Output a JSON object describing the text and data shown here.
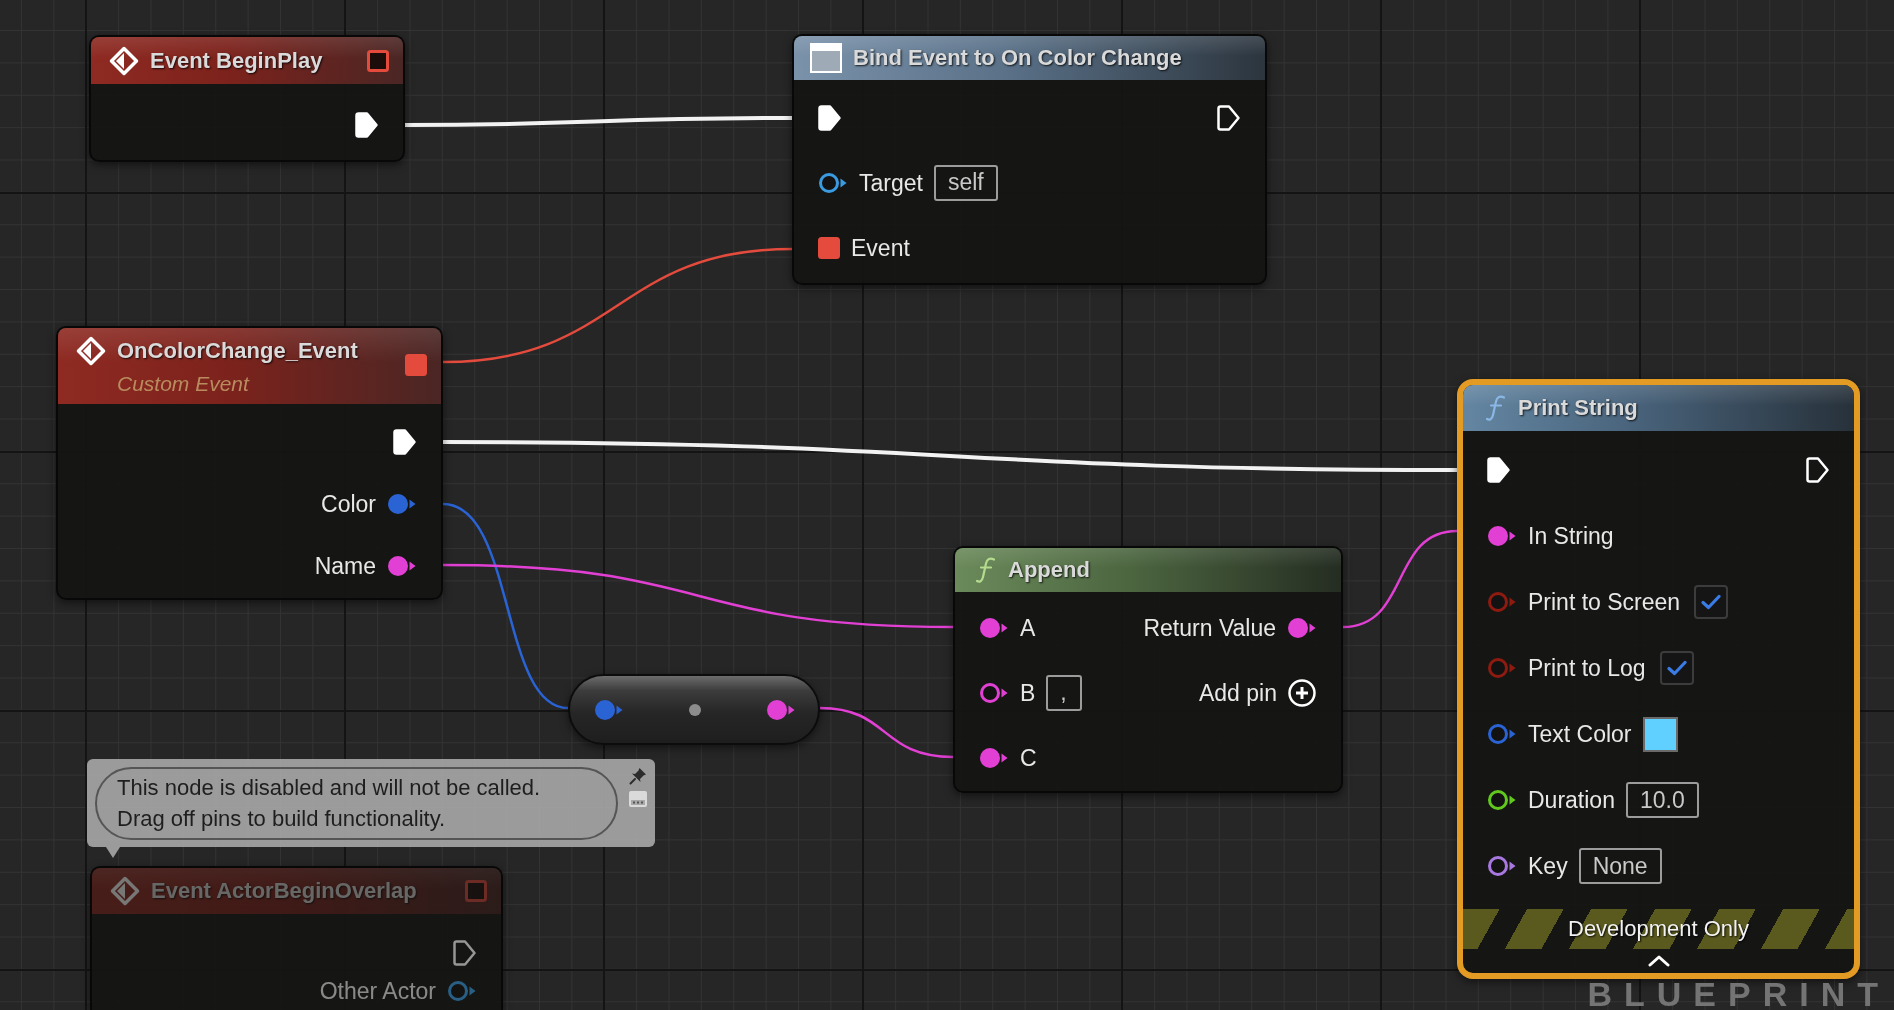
{
  "graph": {
    "corner_label": "BLUEPRINT",
    "nodes": [
      {
        "kind": "event",
        "title": "Event BeginPlay",
        "selected": false,
        "disabled": false,
        "delegate": {
          "connected": false
        },
        "rows": [
          {
            "output": {
              "kind": "exec",
              "connected": true
            }
          }
        ]
      },
      {
        "kind": "bind",
        "title": "Bind Event to On Color Change",
        "selected": false,
        "disabled": false,
        "rows": [
          {
            "input": {
              "kind": "exec",
              "connected": true
            },
            "output": {
              "kind": "exec",
              "connected": false
            }
          },
          {
            "input": {
              "kind": "object",
              "label": "Target",
              "value": "self",
              "connected": false
            }
          },
          {
            "input": {
              "kind": "delegate",
              "label": "Event",
              "connected": true
            }
          }
        ]
      },
      {
        "kind": "event",
        "title": "OnColorChange_Event",
        "subtitle": "Custom Event",
        "selected": false,
        "disabled": false,
        "delegate": {
          "connected": true
        },
        "rows": [
          {
            "output": {
              "kind": "exec",
              "connected": true
            }
          },
          {
            "output": {
              "kind": "struct",
              "label": "Color",
              "connected": true
            }
          },
          {
            "output": {
              "kind": "string",
              "label": "Name",
              "connected": true
            }
          }
        ]
      },
      {
        "kind": "conversion",
        "selected": false,
        "disabled": false,
        "rows": [
          {
            "input": {
              "kind": "struct",
              "connected": true
            },
            "output": {
              "kind": "string",
              "connected": true
            }
          }
        ]
      },
      {
        "kind": "pure",
        "title": "Append",
        "selected": false,
        "disabled": false,
        "rows": [
          {
            "input": {
              "kind": "string",
              "label": "A",
              "connected": true
            },
            "output": {
              "kind": "string",
              "label": "Return Value",
              "connected": true
            }
          },
          {
            "input": {
              "kind": "string",
              "label": "B",
              "value": ",",
              "connected": false
            },
            "output": {
              "kind": "add_pin",
              "label": "Add pin"
            }
          },
          {
            "input": {
              "kind": "string",
              "label": "C",
              "connected": true
            }
          }
        ]
      },
      {
        "kind": "event",
        "title": "Event ActorBeginOverlap",
        "selected": false,
        "disabled": true,
        "comment": "This node is disabled and will not be called.\nDrag off pins to build functionality.",
        "delegate": {
          "connected": false
        },
        "rows": [
          {
            "output": {
              "kind": "exec",
              "connected": false
            }
          },
          {
            "output": {
              "kind": "object",
              "label": "Other Actor",
              "connected": false
            }
          }
        ]
      },
      {
        "kind": "function",
        "title": "Print String",
        "selected": true,
        "disabled": false,
        "banner": "Development Only",
        "advanced_expanded": true,
        "rows": [
          {
            "input": {
              "kind": "exec",
              "connected": true
            },
            "output": {
              "kind": "exec",
              "connected": false
            }
          },
          {
            "input": {
              "kind": "string",
              "label": "In String",
              "connected": true
            }
          },
          {
            "input": {
              "kind": "bool",
              "label": "Print to Screen",
              "checked": true,
              "connected": false
            }
          },
          {
            "input": {
              "kind": "bool",
              "label": "Print to Log",
              "checked": true,
              "connected": false
            }
          },
          {
            "input": {
              "kind": "struct",
              "label": "Text Color",
              "color": "#5fd0ff",
              "connected": false
            }
          },
          {
            "input": {
              "kind": "float",
              "label": "Duration",
              "value": "10.0",
              "connected": false
            }
          },
          {
            "input": {
              "kind": "name",
              "label": "Key",
              "value": "None",
              "connected": false
            }
          }
        ]
      }
    ]
  }
}
